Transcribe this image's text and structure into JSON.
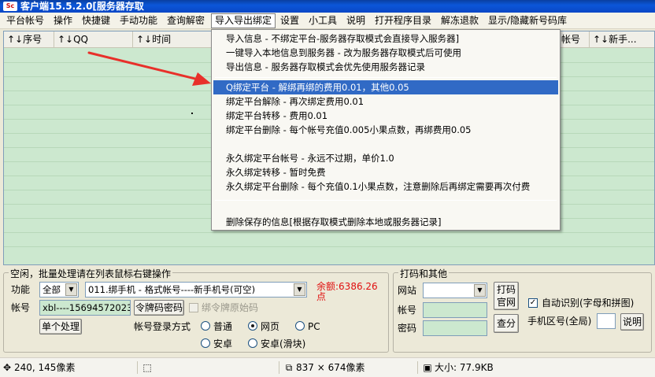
{
  "window": {
    "title": "客户端15.5.2.0[服务器存取",
    "icon": "app-logo-icon"
  },
  "menu": {
    "items": [
      "平台帐号",
      "操作",
      "快捷键",
      "手动功能",
      "查询解密",
      "导入导出绑定",
      "设置",
      "小工具",
      "说明",
      "打开程序目录",
      "解冻退款",
      "显示/隐藏新号码库"
    ],
    "active_index": 5
  },
  "list": {
    "columns": [
      "↑↓序号",
      "↑↓QQ",
      "↑↓时间",
      "",
      "帐号",
      "↑↓新手..."
    ]
  },
  "dropdown": {
    "items": [
      "导入信息 - 不绑定平台-服务器存取模式会直接导入服务器]",
      "一键导入本地信息到服务器 - 改为服务器存取模式后可使用",
      "导出信息 - 服务器存取模式会优先使用服务器记录",
      "Q绑定平台 - 解绑再绑的费用0.01，其他0.05",
      "绑定平台解除 - 再次绑定费用0.01",
      "绑定平台转移 - 费用0.01",
      "绑定平台删除 - 每个帐号充值0.005小果点数，再绑费用0.05",
      "永久绑定平台帐号 - 永远不过期，单价1.0",
      "永久绑定转移 - 暂时免费",
      "永久绑定平台删除 - 每个充值0.1小果点数，注意删除后再绑定需要再次付费",
      "删除保存的信息[根据存取模式删除本地或服务器记录]"
    ],
    "selected_index": 3
  },
  "batch": {
    "title": "空闲，批量处理请在列表鼠标右键操作",
    "func_label": "功能",
    "func_select": "全部",
    "func_value": "011.绑手机 - 格式帐号----新手机号(可空)",
    "balance": "余额:6386.26点",
    "account_label": "帐号",
    "account_value": "xbl----15694572023",
    "token_button": "令牌码密码",
    "bind_token_label": "绑令牌原始码",
    "single_button": "单个处理",
    "login_mode_label": "帐号登录方式",
    "modes": [
      "普通",
      "网页",
      "PC",
      "安卓",
      "安卓(滑块)"
    ],
    "mode_selected": 1
  },
  "captcha": {
    "title": "打码和其他",
    "site_label": "网站",
    "account_label": "帐号",
    "password_label": "密码",
    "official_button": "打码官网",
    "query_button": "查分",
    "auto_recognize_label": "自动识别(字母和拼图)",
    "auto_recognize_checked": true,
    "region_label": "手机区号(全局)",
    "help_button": "说明"
  },
  "status": {
    "coords": "240, 145像素",
    "dimensions": "837 × 674像素",
    "size": "大小: 77.9KB"
  },
  "colors": {
    "arrow": "#E8302A",
    "selection": "#316AC5",
    "list_bg": "#CCE8CF"
  }
}
